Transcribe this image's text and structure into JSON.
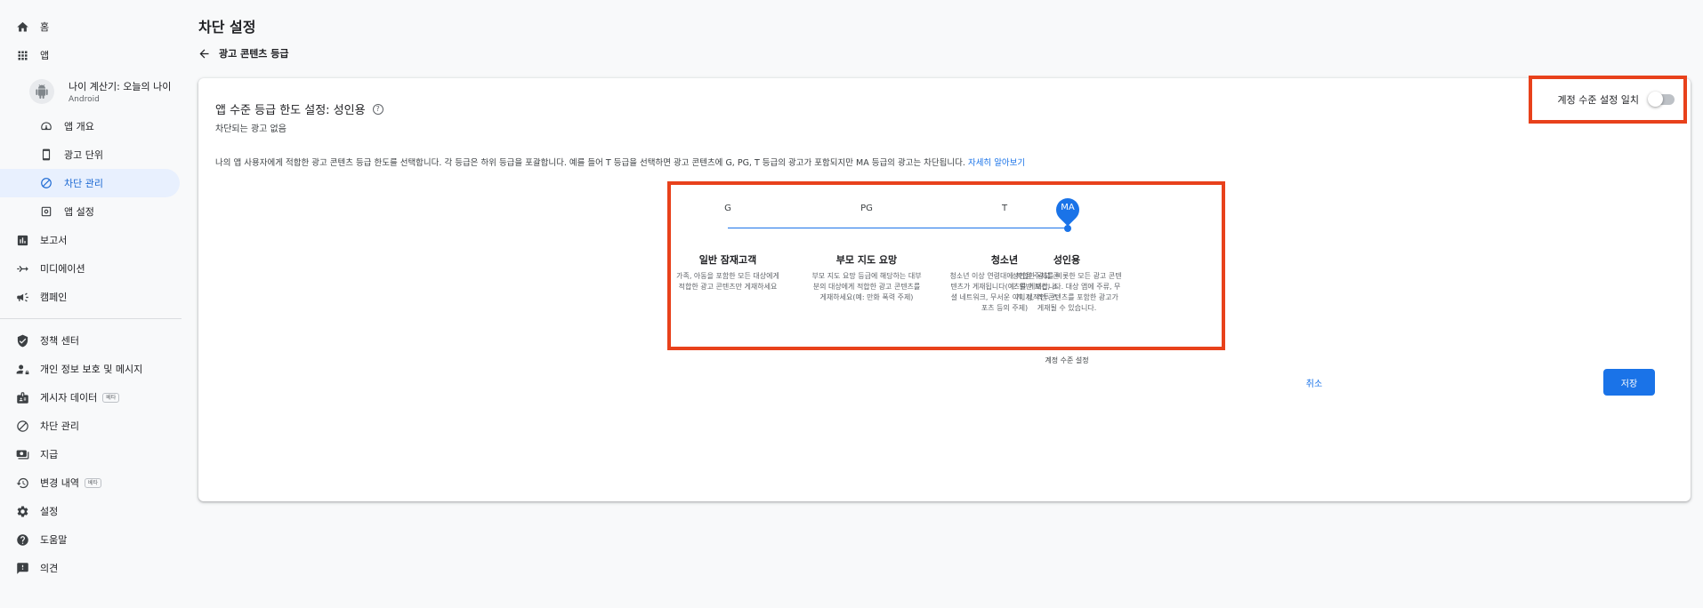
{
  "sidebar": {
    "home": "홈",
    "apps": "앱",
    "app_name": "나이 계산기: 오늘의 나이",
    "app_platform": "Android",
    "app_overview": "앱 개요",
    "ad_units": "광고 단위",
    "blocking_controls": "차단 관리",
    "app_settings": "앱 설정",
    "reports": "보고서",
    "mediation": "미디에이션",
    "campaigns": "캠페인",
    "policy_center": "정책 센터",
    "privacy_messaging": "개인 정보 보호 및 메시지",
    "publisher_data": "게시자 데이터",
    "beta": "베타",
    "blocking_controls_2": "차단 관리",
    "payments": "지급",
    "change_history": "변경 내역",
    "settings": "설정",
    "help": "도움말",
    "feedback": "의견"
  },
  "header": {
    "title": "차단 설정",
    "back_label": "광고 콘텐츠 등급"
  },
  "card": {
    "title": "앱 수준 등급 한도 설정: 성인용",
    "help_glyph": "?",
    "subtitle": "차단되는 광고 없음",
    "description": "나의 앱 사용자에게 적합한 광고 콘텐츠 등급 한도를 선택합니다. 각 등급은 하위 등급을 포괄합니다. 예를 들어 T 등급을 선택하면 광고 콘텐츠에 G, PG, T 등급의 광고가 포함되지만 MA 등급의 광고는 차단됩니다.",
    "learn_more": "자세히 알아보기",
    "toggle_label": "계정 수준 설정 일치",
    "toggle_on": false,
    "levels": [
      {
        "code": "G",
        "title": "일반 잠재고객",
        "desc": "가족, 아동을 포함한 모든 대상에게 적합한 광고 콘텐츠만 게재하세요"
      },
      {
        "code": "PG",
        "title": "부모 지도 요망",
        "desc": "부모 지도 요망 등급에 해당하는 대부분의 대상에게 적합한 광고 콘텐츠를 게재하세요(예: 만화 폭력 주제)"
      },
      {
        "code": "T",
        "title": "청소년",
        "desc": "청소년 이상 연령대에 적합한 광고 콘텐츠가 게재됩니다(예: 일반 보건, 소셜 네트워크, 무서운 이미지, 격투 스포츠 등의 주제)"
      },
      {
        "code": "MA",
        "title": "성인용",
        "desc": "성인용 주제를 비롯한 모든 광고 콘텐츠를 게재합니다. 대상 앱에 주류, 무기, 성적인 콘텐츠를 포함한 광고가 게재될 수 있습니다."
      }
    ],
    "selected_level": "MA",
    "account_level_note": "계정 수준 설정",
    "cancel": "취소",
    "save": "저장"
  },
  "colors": {
    "accent": "#1a73e8",
    "highlight_border": "#e8411b",
    "active_nav_bg": "#e8f0fe"
  }
}
